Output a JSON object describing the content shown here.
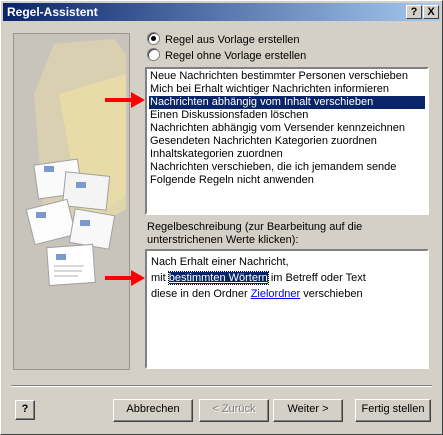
{
  "window": {
    "title": "Regel-Assistent",
    "help_glyph": "?",
    "close_glyph": "X"
  },
  "options": {
    "from_template": "Regel aus Vorlage erstellen",
    "without_template": "Regel ohne Vorlage erstellen",
    "selected": "from_template"
  },
  "templates": {
    "items": [
      "Neue Nachrichten bestimmter Personen verschieben",
      "Mich bei Erhalt wichtiger Nachrichten informieren",
      "Nachrichten abhängig vom Inhalt verschieben",
      "Einen Diskussionsfaden löschen",
      "Nachrichten abhängig vom Versender kennzeichnen",
      "Gesendeten Nachrichten Kategorien zuordnen",
      "Inhaltskategorien zuordnen",
      "Nachrichten verschieben, die ich jemandem sende",
      "Folgende Regeln nicht anwenden"
    ],
    "selected_index": 2
  },
  "description": {
    "label": "Regelbeschreibung (zur Bearbeitung auf die unterstrichenen Werte klicken):",
    "line1": "Nach Erhalt einer Nachricht,",
    "line2_prefix": "mit",
    "line2_link": "bestimmten Wörtern",
    "line2_suffix": "im Betreff oder Text",
    "line3_prefix": "diese in den Ordner",
    "line3_link": "Zielordner",
    "line3_suffix": "verschieben"
  },
  "buttons": {
    "help": "?",
    "cancel": "Abbrechen",
    "back": "< Zurück",
    "next": "Weiter >",
    "finish": "Fertig stellen"
  },
  "colors": {
    "title_bar": "#0a246a",
    "selection": "#0a246a",
    "arrow": "#ff0000",
    "link": "#0000ff"
  }
}
